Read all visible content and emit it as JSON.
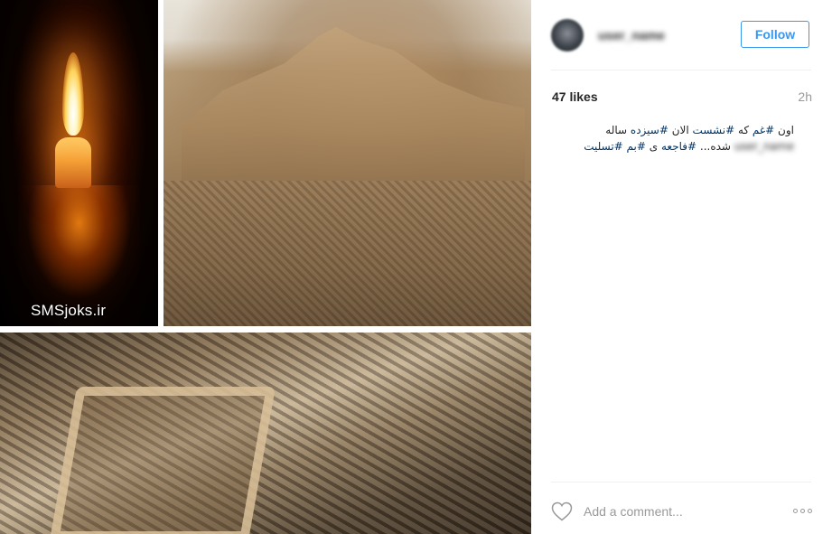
{
  "media": {
    "watermark": "SMSjoks.ir"
  },
  "header": {
    "username": "user_name",
    "follow_label": "Follow",
    "follow_color": "#3897f0"
  },
  "post": {
    "likes": "47 likes",
    "timestamp": "2h"
  },
  "caption": {
    "w1": "اون ",
    "h1": "#غم",
    "w2": " که ",
    "h2": "#نشست",
    "w3": " الان ",
    "h3": "#سیزده",
    "w4": " ساله ",
    "mention": "user_name",
    "w5": " شده... ",
    "h4": "#فاجعه",
    "w6": " ی ",
    "h5": "#بم",
    "w7": " ",
    "h6": "#تسلیت",
    "hashtag_color": "#003569"
  },
  "comment": {
    "placeholder": "Add a comment...",
    "like_icon": "heart-icon",
    "more_icon": "more-options-icon"
  }
}
